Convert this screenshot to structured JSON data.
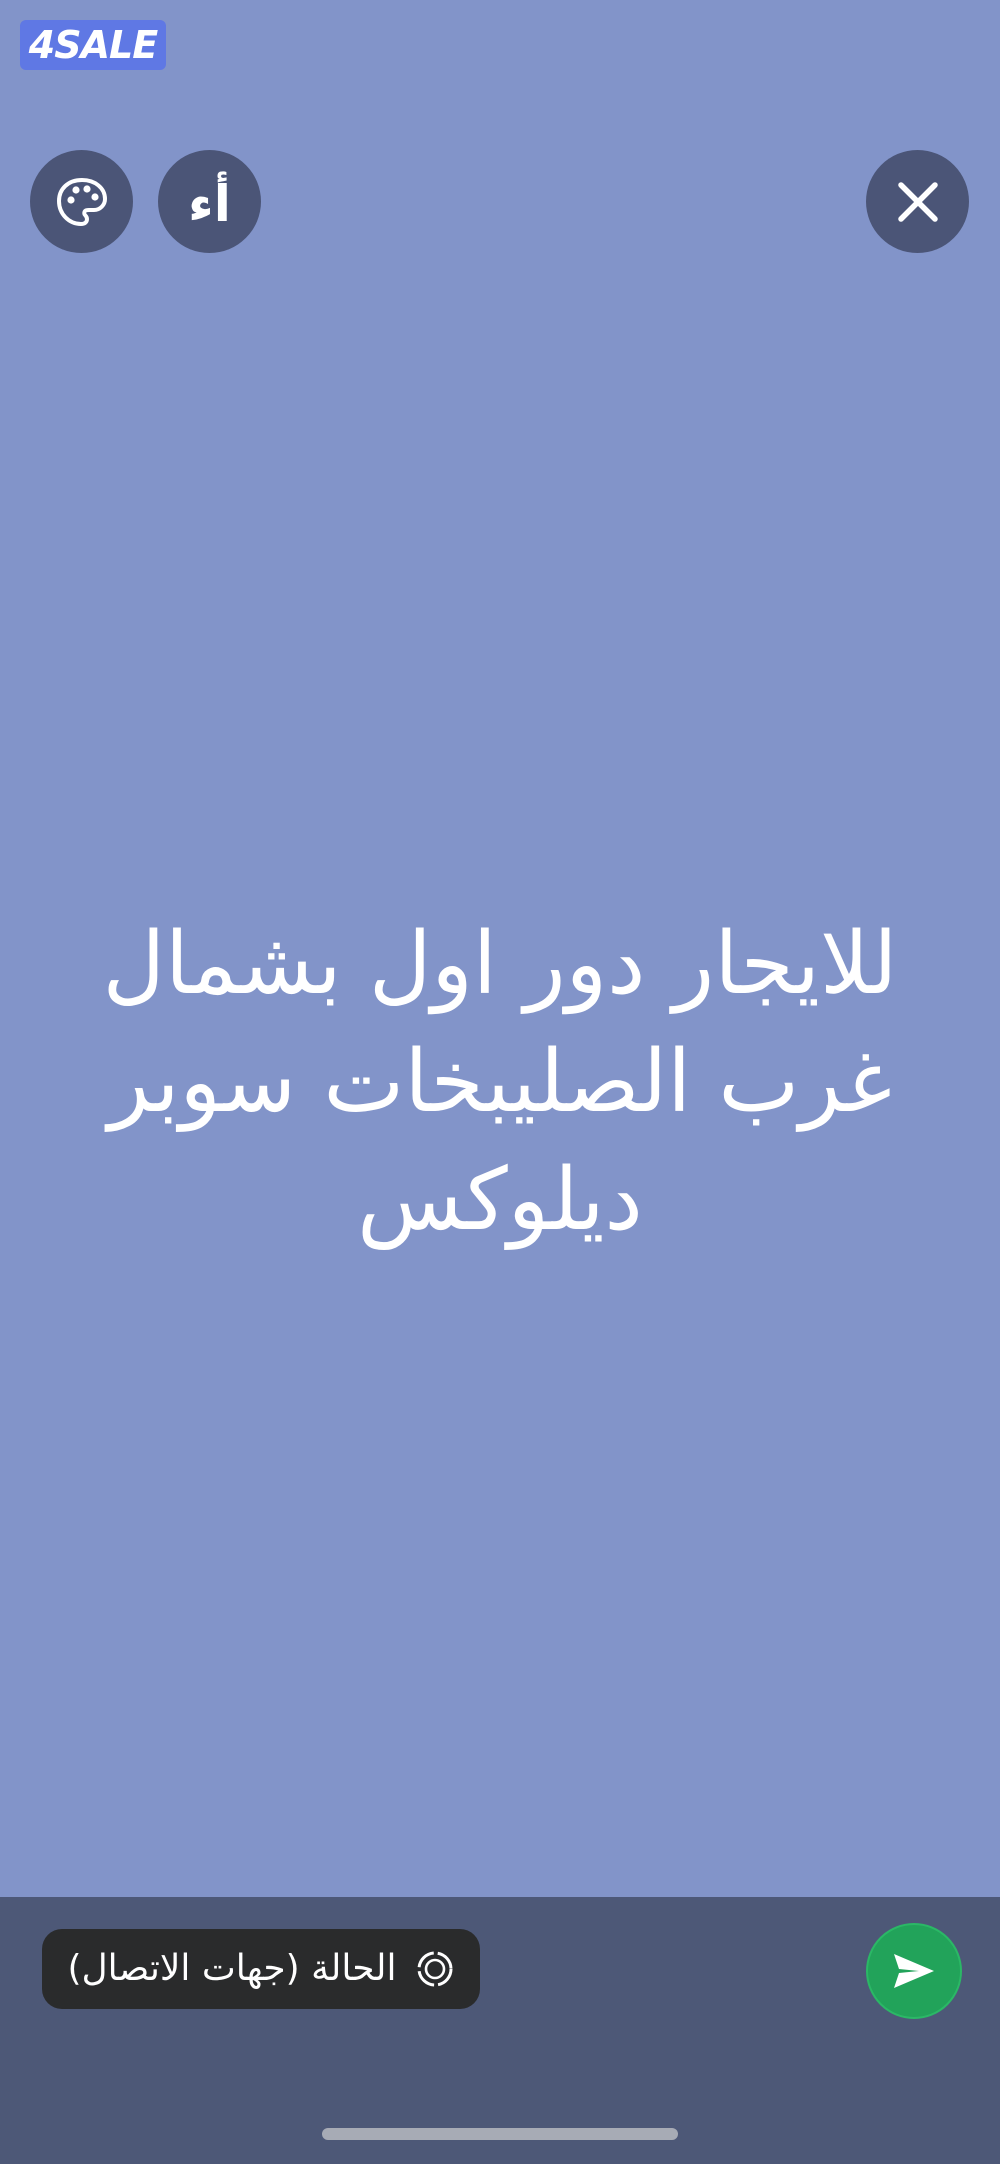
{
  "branding": {
    "logo_text": "4SALE"
  },
  "toolbar": {
    "palette_icon": "palette-icon",
    "font_button_label": "أء",
    "close_icon": "close-icon"
  },
  "status": {
    "text": "للايجار دور اول بشمال غرب الصليبخات سوبر ديلوكس"
  },
  "footer": {
    "audience_icon": "status-ring-icon",
    "audience_label": "الحالة (جهات الاتصال)",
    "send_icon": "send-icon"
  },
  "colors": {
    "background": "#8294c9",
    "toolbar_button": "#4b5577",
    "bottom_bar": "#4d5877",
    "audience_pill": "#2a2b2c",
    "send_button": "#22a35a",
    "logo_background": "#5f78e4"
  }
}
